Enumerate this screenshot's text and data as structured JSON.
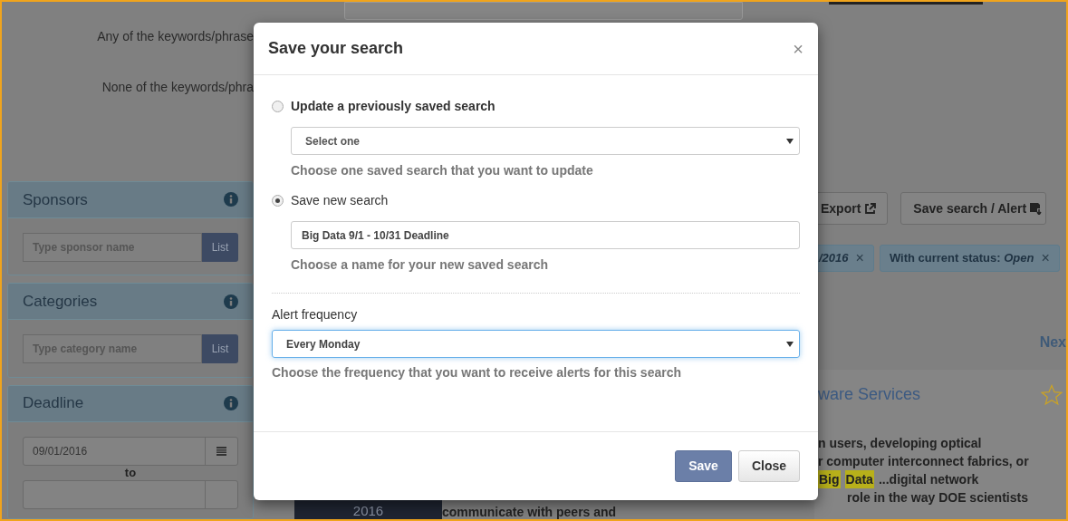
{
  "background": {
    "keyword_labels": [
      "Any of the keywords/phrase",
      "None of the keywords/phra"
    ],
    "filter_panels": [
      {
        "title": "Sponsors",
        "kind": "search",
        "placeholder": "Type sponsor name",
        "button": "List"
      },
      {
        "title": "Categories",
        "kind": "search",
        "placeholder": "Type category name",
        "button": "List"
      },
      {
        "title": "Deadline",
        "kind": "dates",
        "from": "09/01/2016",
        "separator": "to"
      }
    ],
    "toolbar": [
      "Export",
      "Save search / Alert"
    ],
    "filter_tags": [
      {
        "value": "/2016",
        "remove": "×"
      },
      {
        "label": "With current status:",
        "value": "Open",
        "remove": "×"
      }
    ],
    "pager": "Nex",
    "result": {
      "title": "ware Services",
      "starred": false,
      "date_year": "2016",
      "lines": [
        [
          {
            "text": "n users, developing optical",
            "highlighted": false
          }
        ],
        [
          {
            "text": "r computer interconnect fabrics, or",
            "highlighted": false
          }
        ],
        [
          {
            "text": "Big",
            "highlighted": true
          },
          {
            "text": "Data",
            "highlighted": true
          },
          {
            "text": "...digital network",
            "highlighted": false
          }
        ],
        [
          {
            "text": "role in the way DOE scientists",
            "highlighted": false
          }
        ]
      ],
      "last_line": "communicate with peers and"
    }
  },
  "dialog": {
    "title": "Save your search",
    "close": "×",
    "options": [
      {
        "label": "Update a previously saved search",
        "emphasized": true,
        "selected": false,
        "kind": "select",
        "value": "Select one",
        "help": "Choose one saved search that you want to update"
      },
      {
        "label": "Save new search",
        "emphasized": false,
        "selected": true,
        "kind": "text",
        "value": "Big Data 9/1 - 10/31 Deadline",
        "help": "Choose a name for your new saved search"
      }
    ],
    "alert": {
      "label": "Alert frequency",
      "value": "Every Monday",
      "focused": true,
      "help": "Choose the frequency that you want to receive alerts for this search"
    },
    "buttons": [
      {
        "label": "Save",
        "kind": "primary"
      },
      {
        "label": "Close",
        "kind": "default"
      }
    ]
  }
}
